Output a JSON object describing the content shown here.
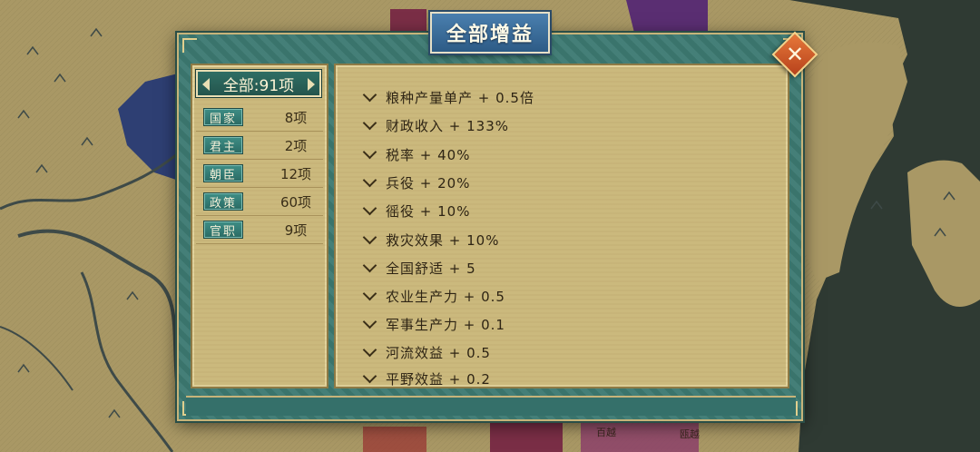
{
  "dialog": {
    "title": "全部增益",
    "close_icon": "close-icon",
    "colors": {
      "frame": "#3d7a72",
      "panel": "#cbb97d",
      "title_plate": "#3a6c9a",
      "close": "#d45a28"
    }
  },
  "filter": {
    "all_label": "全部:91项",
    "categories": [
      {
        "label": "国家",
        "count": "8项"
      },
      {
        "label": "君主",
        "count": "2项"
      },
      {
        "label": "朝臣",
        "count": "12项"
      },
      {
        "label": "政策",
        "count": "60项"
      },
      {
        "label": "官职",
        "count": "9项"
      }
    ]
  },
  "bonuses": [
    "粮种产量单产 + 0.5倍",
    "财政收入 + 133%",
    "税率 + 40%",
    "兵役 + 20%",
    "徭役 + 10%",
    "救灾效果 + 10%",
    "全国舒适 + 5",
    "农业生产力 + 0.5",
    "军事生产力 + 0.1",
    "河流效益 + 0.5",
    "平野效益 + 0.2"
  ],
  "map": {
    "labels": [
      "百越",
      "瓯越"
    ]
  }
}
